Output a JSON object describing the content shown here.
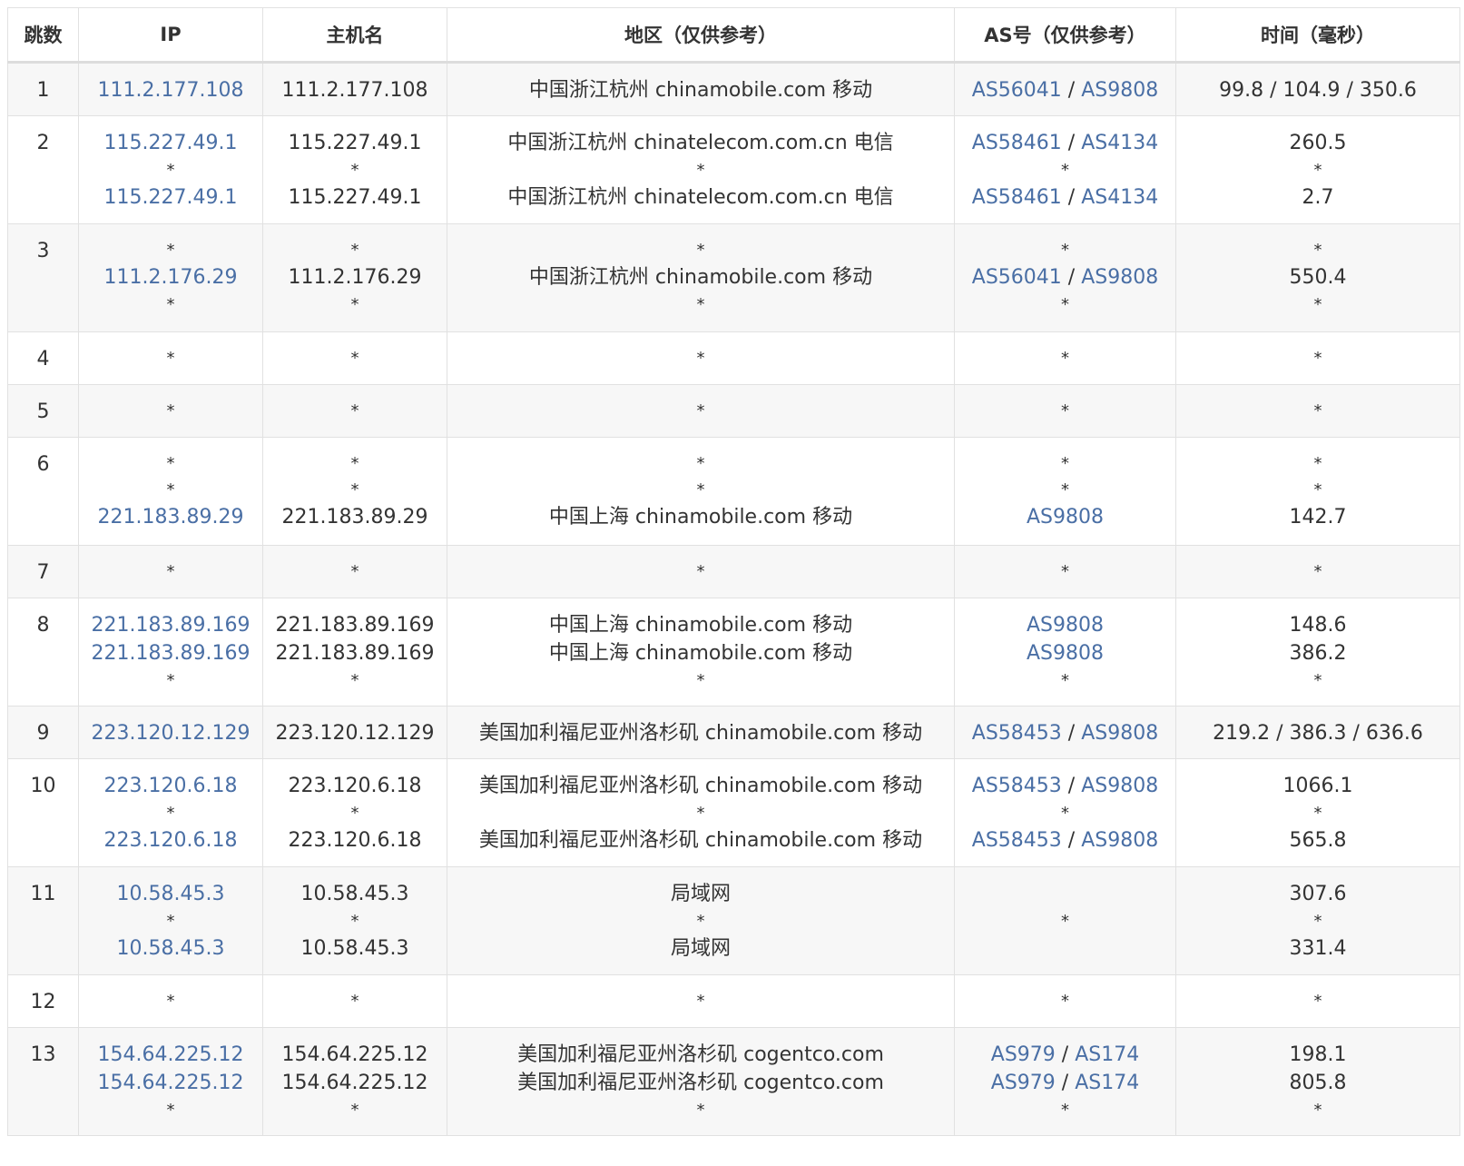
{
  "columns": [
    "跳数",
    "IP",
    "主机名",
    "地区（仅供参考）",
    "AS号（仅供参考）",
    "时间（毫秒）"
  ],
  "link_color": "#4a6fa5",
  "hops": [
    {
      "hop": "1",
      "height": 58,
      "rows": [
        {
          "ip": "111.2.177.108",
          "host": "111.2.177.108",
          "region": "中国浙江杭州 chinamobile.com 移动",
          "as": [
            "AS56041",
            "AS9808"
          ],
          "time": "99.8 / 104.9 / 350.6"
        }
      ]
    },
    {
      "hop": "2",
      "height": 119,
      "rows": [
        {
          "ip": "115.227.49.1",
          "host": "115.227.49.1",
          "region": "中国浙江杭州 chinatelecom.com.cn 电信",
          "as": [
            "AS58461",
            "AS4134"
          ],
          "time": "260.5"
        },
        {
          "ip": "*",
          "host": "*",
          "region": "*",
          "as": [],
          "time": "*"
        },
        {
          "ip": "115.227.49.1",
          "host": "115.227.49.1",
          "region": "中国浙江杭州 chinatelecom.com.cn 电信",
          "as": [
            "AS58461",
            "AS4134"
          ],
          "time": "2.7"
        }
      ]
    },
    {
      "hop": "3",
      "height": 119,
      "rows": [
        {
          "ip": "*",
          "host": "*",
          "region": "*",
          "as": [],
          "time": "*"
        },
        {
          "ip": "111.2.176.29",
          "host": "111.2.176.29",
          "region": "中国浙江杭州 chinamobile.com 移动",
          "as": [
            "AS56041",
            "AS9808"
          ],
          "time": "550.4"
        },
        {
          "ip": "*",
          "host": "*",
          "region": "*",
          "as": [],
          "time": "*"
        }
      ]
    },
    {
      "hop": "4",
      "height": 57,
      "rows": [
        {
          "ip": "*",
          "host": "*",
          "region": "*",
          "as": [],
          "time": "*"
        }
      ]
    },
    {
      "hop": "5",
      "height": 57,
      "rows": [
        {
          "ip": "*",
          "host": "*",
          "region": "*",
          "as": [],
          "time": "*"
        }
      ]
    },
    {
      "hop": "6",
      "height": 119,
      "rows": [
        {
          "ip": "*",
          "host": "*",
          "region": "*",
          "as": [],
          "time": "*"
        },
        {
          "ip": "*",
          "host": "*",
          "region": "*",
          "as": [],
          "time": "*"
        },
        {
          "ip": "221.183.89.29",
          "host": "221.183.89.29",
          "region": "中国上海 chinamobile.com 移动",
          "as": [
            "AS9808"
          ],
          "time": "142.7"
        }
      ]
    },
    {
      "hop": "7",
      "height": 57,
      "rows": [
        {
          "ip": "*",
          "host": "*",
          "region": "*",
          "as": [],
          "time": "*"
        }
      ]
    },
    {
      "hop": "8",
      "height": 119,
      "rows": [
        {
          "ip": "221.183.89.169",
          "host": "221.183.89.169",
          "region": "中国上海 chinamobile.com 移动",
          "as": [
            "AS9808"
          ],
          "time": "148.6"
        },
        {
          "ip": "221.183.89.169",
          "host": "221.183.89.169",
          "region": "中国上海 chinamobile.com 移动",
          "as": [
            "AS9808"
          ],
          "time": "386.2"
        },
        {
          "ip": "*",
          "host": "*",
          "region": "*",
          "as": [],
          "time": "*"
        }
      ]
    },
    {
      "hop": "9",
      "height": 58,
      "rows": [
        {
          "ip": "223.120.12.129",
          "host": "223.120.12.129",
          "region": "美国加利福尼亚州洛杉矶 chinamobile.com 移动",
          "as": [
            "AS58453",
            "AS9808"
          ],
          "time": "219.2 / 386.3 / 636.6"
        }
      ]
    },
    {
      "hop": "10",
      "height": 119,
      "rows": [
        {
          "ip": "223.120.6.18",
          "host": "223.120.6.18",
          "region": "美国加利福尼亚州洛杉矶 chinamobile.com 移动",
          "as": [
            "AS58453",
            "AS9808"
          ],
          "time": "1066.1"
        },
        {
          "ip": "*",
          "host": "*",
          "region": "*",
          "as": [],
          "time": "*"
        },
        {
          "ip": "223.120.6.18",
          "host": "223.120.6.18",
          "region": "美国加利福尼亚州洛杉矶 chinamobile.com 移动",
          "as": [
            "AS58453",
            "AS9808"
          ],
          "time": "565.8"
        }
      ]
    },
    {
      "hop": "11",
      "height": 119,
      "rows": [
        {
          "ip": "10.58.45.3",
          "host": "10.58.45.3",
          "region": "局域网",
          "as": [],
          "time": "307.6"
        },
        {
          "ip": "*",
          "host": "*",
          "region": "*",
          "as": [],
          "time": "*"
        },
        {
          "ip": "10.58.45.3",
          "host": "10.58.45.3",
          "region": "局域网",
          "as": [],
          "time": "331.4"
        }
      ]
    },
    {
      "hop": "12",
      "height": 57,
      "rows": [
        {
          "ip": "*",
          "host": "*",
          "region": "*",
          "as": [],
          "time": "*"
        }
      ]
    },
    {
      "hop": "13",
      "height": 119,
      "rows": [
        {
          "ip": "154.64.225.12",
          "host": "154.64.225.12",
          "region": "美国加利福尼亚州洛杉矶 cogentco.com",
          "as": [
            "AS979",
            "AS174"
          ],
          "time": "198.1"
        },
        {
          "ip": "154.64.225.12",
          "host": "154.64.225.12",
          "region": "美国加利福尼亚州洛杉矶 cogentco.com",
          "as": [
            "AS979",
            "AS174"
          ],
          "time": "805.8"
        },
        {
          "ip": "*",
          "host": "*",
          "region": "*",
          "as": [],
          "time": "*"
        }
      ]
    }
  ],
  "hop11_as_middle": "*"
}
